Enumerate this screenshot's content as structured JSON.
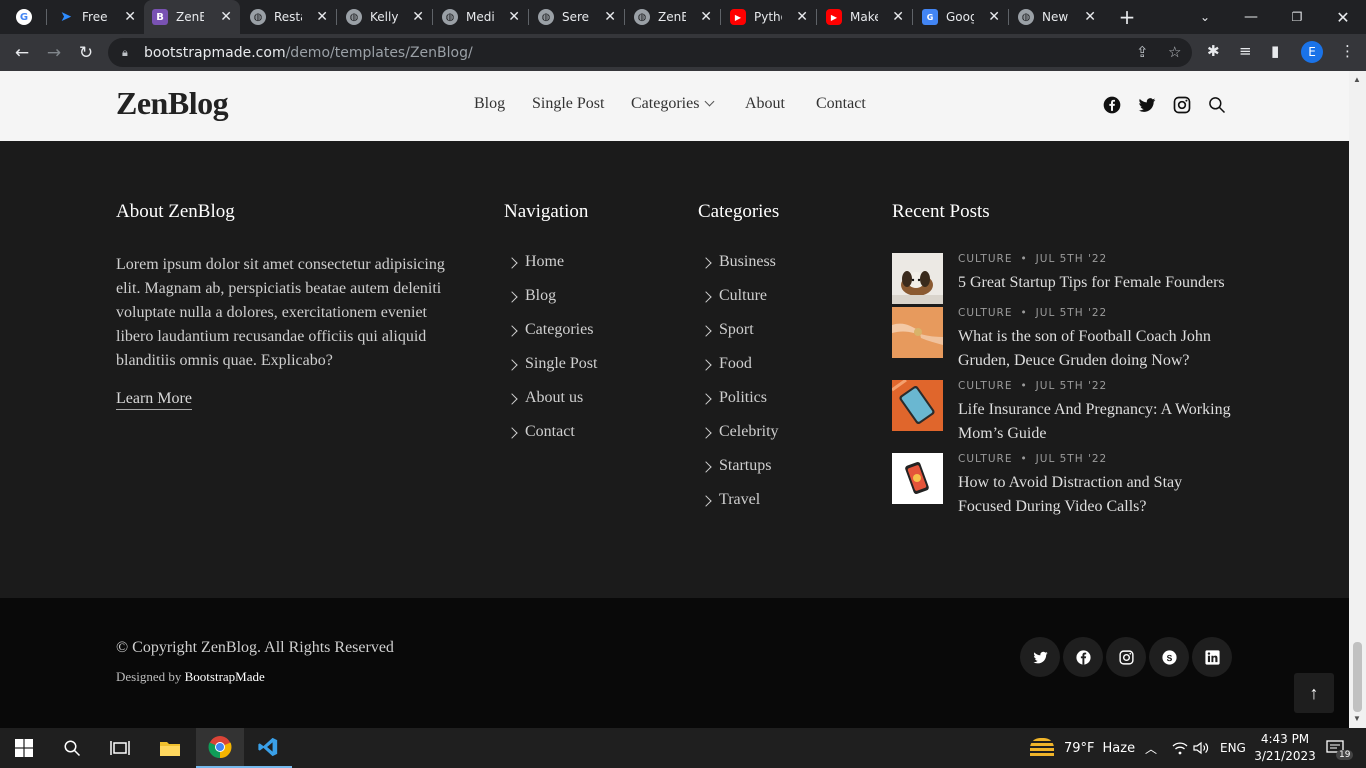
{
  "browser": {
    "tabs": [
      {
        "title": "",
        "icon": "google-icon",
        "active": false
      },
      {
        "title": "Free B",
        "icon": "bootstrap-logo-icon",
        "active": false
      },
      {
        "title": "ZenBl",
        "icon": "bootstrap-b-icon",
        "active": true
      },
      {
        "title": "Restau",
        "icon": "globe-icon",
        "active": false
      },
      {
        "title": "Kelly E",
        "icon": "globe-icon",
        "active": false
      },
      {
        "title": "Medic",
        "icon": "globe-icon",
        "active": false
      },
      {
        "title": "Seren",
        "icon": "globe-icon",
        "active": false
      },
      {
        "title": "ZenBl",
        "icon": "globe-icon",
        "active": false
      },
      {
        "title": "Pytho",
        "icon": "youtube-icon",
        "active": false
      },
      {
        "title": "Make",
        "icon": "youtube-icon",
        "active": false
      },
      {
        "title": "Googl",
        "icon": "google-docs-icon",
        "active": false
      },
      {
        "title": "New T",
        "icon": "globe-icon",
        "active": false
      }
    ],
    "url_host": "bootstrapmade.com",
    "url_path": "/demo/templates/ZenBlog/",
    "profile_initial": "E"
  },
  "site": {
    "logo": "ZenBlog",
    "nav": {
      "blog": "Blog",
      "single_post": "Single Post",
      "categories": "Categories",
      "about": "About",
      "contact": "Contact"
    }
  },
  "footer": {
    "about": {
      "title": "About ZenBlog",
      "text": "Lorem ipsum dolor sit amet consectetur adipisicing elit. Magnam ab, perspiciatis beatae autem deleniti voluptate nulla a dolores, exercitationem eveniet libero laudantium recusandae officiis qui aliquid blanditiis omnis quae. Explicabo?",
      "learn_more": "Learn More"
    },
    "navigation": {
      "title": "Navigation",
      "items": [
        "Home",
        "Blog",
        "Categories",
        "Single Post",
        "About us",
        "Contact"
      ]
    },
    "categories": {
      "title": "Categories",
      "items": [
        "Business",
        "Culture",
        "Sport",
        "Food",
        "Politics",
        "Celebrity",
        "Startups",
        "Travel"
      ]
    },
    "recent_posts": {
      "title": "Recent Posts",
      "posts": [
        {
          "category": "CULTURE",
          "date": "JUL 5TH '22",
          "title": "5 Great Startup Tips for Female Founders"
        },
        {
          "category": "CULTURE",
          "date": "JUL 5TH '22",
          "title": "What is the son of Football Coach John Gruden, Deuce Gruden doing Now?"
        },
        {
          "category": "CULTURE",
          "date": "JUL 5TH '22",
          "title": "Life Insurance And Pregnancy: A Working Mom’s Guide"
        },
        {
          "category": "CULTURE",
          "date": "JUL 5TH '22",
          "title": "How to Avoid Distraction and Stay Focused During Video Calls?"
        }
      ]
    },
    "copyright": "© Copyright ZenBlog. All Rights Reserved",
    "designed_prefix": "Designed by ",
    "designed_by": "BootstrapMade"
  },
  "taskbar": {
    "weather_temp": "79°F",
    "weather_desc": "Haze",
    "language": "ENG",
    "time": "4:43 PM",
    "date": "3/21/2023",
    "notifications": "19"
  }
}
